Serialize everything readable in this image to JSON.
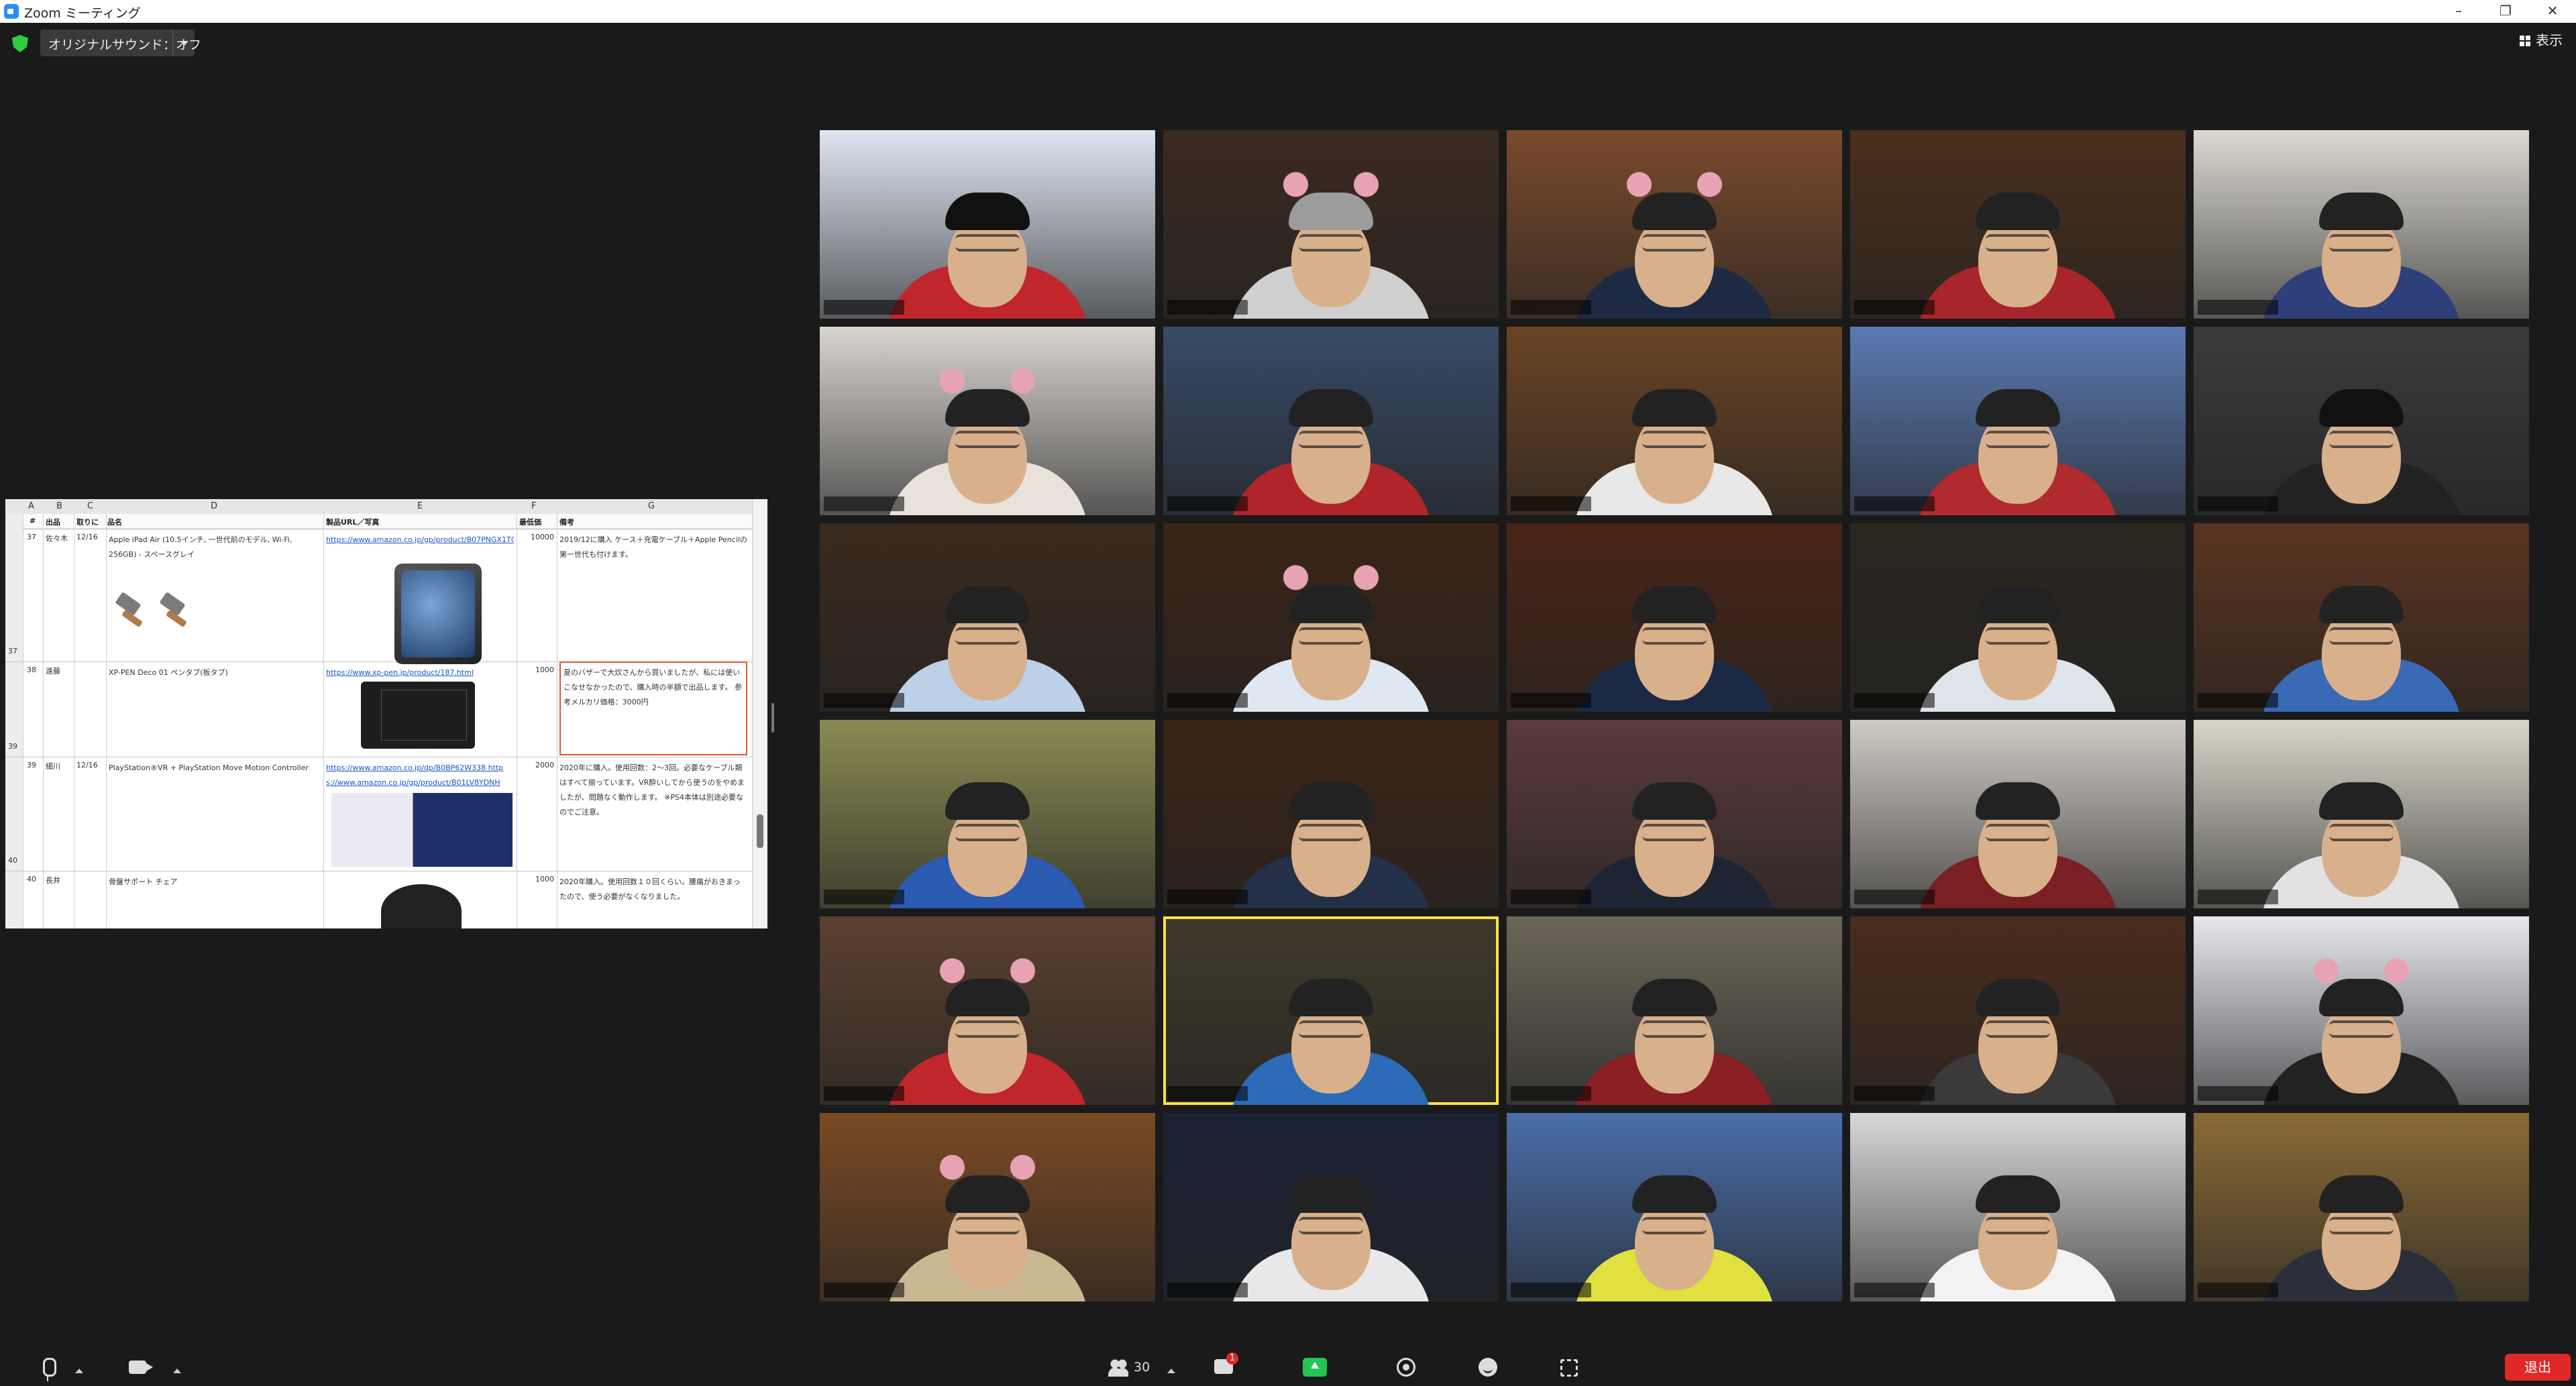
{
  "window": {
    "title": "Zoom ミーティング",
    "controls": [
      "–",
      "❐",
      "✕"
    ]
  },
  "top": {
    "sound_label": "オリジナルサウンド：オフ",
    "view_label": "表示"
  },
  "spreadsheet": {
    "columns": [
      "A",
      "B",
      "C",
      "D",
      "E",
      "F",
      "G"
    ],
    "headers": [
      "#",
      "出品",
      "取りに",
      "品名",
      "製品URL／写真",
      "最低価",
      "備考"
    ],
    "rows": [
      {
        "row_no": "37",
        "a": "37",
        "b": "佐々木",
        "c": "12/16",
        "d": "Apple iPad Air (10.5インチ, 一世代前のモデル, Wi-Fi, 256GB) - スペースグレイ",
        "e": "https://www.amazon.co.jp/gp/product/B07PNGX1TQ/",
        "f": "10000",
        "g": "2019/12に購入 ケース＋充電ケーブル＋Apple Pencilの第一世代も付けます。"
      },
      {
        "row_no": "39",
        "a": "38",
        "b": "遠藤",
        "c": "",
        "d": "XP-PEN Deco 01 ペンタブ(板タブ)",
        "e": "https://www.xp-pen.jp/product/187.html",
        "f": "1000",
        "g": "夏のバザーで大炊さんから買いましたが、私には使いこなせなかったので、購入時の半額で出品します。 参考メルカリ価格：3000円"
      },
      {
        "row_no": "40",
        "a": "39",
        "b": "細川",
        "c": "12/16",
        "d": "PlayStation®VR + PlayStation Move Motion Controller",
        "e": "https://www.amazon.co.jp/dp/B0BP62W338 https://www.amazon.co.jp/gp/product/B01LV8YDNH",
        "f": "2000",
        "g": "2020年に購入。使用回数：2〜3回。必要なケーブル類はすべて揃っています。VR酔いしてから使うのをやめましたが、問題なく動作します。 ※PS4本体は別途必要なのでご注意。"
      },
      {
        "row_no": "",
        "a": "40",
        "b": "長井",
        "c": "",
        "d": "骨盤サポート チェア",
        "e": "",
        "f": "1000",
        "g": "2020年購入。使用回数１０回くらい。腰痛がおきまったので、使う必要がなくなりました。"
      }
    ]
  },
  "grid": {
    "columns": 5,
    "rows": 6,
    "active_tile": 21,
    "tiles": [
      {
        "bg": "#dfe6f2",
        "shirt": "#c0262c",
        "hair": "#111",
        "filter": "crown"
      },
      {
        "bg": "#3b2a20",
        "shirt": "#cfcfcf",
        "hair": "#9c9c9c",
        "filter": "unicorn"
      },
      {
        "bg": "#7a4a2c",
        "shirt": "#1e2a44",
        "hair": "#222",
        "filter": "bunny"
      },
      {
        "bg": "#4a2f1c",
        "shirt": "#a8262b",
        "hair": "#222",
        "filter": "crown"
      },
      {
        "bg": "#dcd9d2",
        "shirt": "#2f3f7a",
        "hair": "#222",
        "filter": "group"
      },
      {
        "bg": "#d8d4cf",
        "shirt": "#e8e2da",
        "hair": "#222",
        "filter": "unicorn"
      },
      {
        "bg": "#384a66",
        "shirt": "#b0252a",
        "hair": "#222",
        "filter": "mustache"
      },
      {
        "bg": "#6a4424",
        "shirt": "#e8e8e8",
        "hair": "#222",
        "filter": "headphones"
      },
      {
        "bg": "#5b79b2",
        "shirt": "#b02a2e",
        "hair": "#222",
        "filter": "flowers"
      },
      {
        "bg": "#3c3a3c",
        "shirt": "#222",
        "hair": "#111",
        "filter": "none"
      },
      {
        "bg": "#3a2a1e",
        "shirt": "#bcd0e8",
        "hair": "#222",
        "filter": "sunglasses"
      },
      {
        "bg": "#3b2416",
        "shirt": "#dfe8f2",
        "hair": "#222",
        "filter": "ears"
      },
      {
        "bg": "#4a2416",
        "shirt": "#1b2a44",
        "hair": "#222",
        "filter": "zzz"
      },
      {
        "bg": "#2a2620",
        "shirt": "#dfe3ea",
        "hair": "#222",
        "filter": "sprout"
      },
      {
        "bg": "#5a3420",
        "shirt": "#3a6ab6",
        "hair": "#222",
        "filter": "none"
      },
      {
        "bg": "#8a8a52",
        "shirt": "#2b5bb0",
        "hair": "#222",
        "filter": "crown"
      },
      {
        "bg": "#3b2416",
        "shirt": "#233047",
        "hair": "#222",
        "filter": "none"
      },
      {
        "bg": "#5b3a3a",
        "shirt": "#1d2433",
        "hair": "#222",
        "filter": "crown"
      },
      {
        "bg": "#cfcac4",
        "shirt": "#7a1f24",
        "hair": "#222",
        "filter": "group"
      },
      {
        "bg": "#d8d6c8",
        "shirt": "#e2e2e2",
        "hair": "#222",
        "filter": "group"
      },
      {
        "bg": "#5b4030",
        "shirt": "#c0262c",
        "hair": "#222",
        "filter": "ears"
      },
      {
        "bg": "#3f3a2a",
        "shirt": "#2d6ab8",
        "hair": "#222",
        "filter": "none"
      },
      {
        "bg": "#6b6658",
        "shirt": "#8a1f24",
        "hair": "#222",
        "filter": "none"
      },
      {
        "bg": "#4a2c1c",
        "shirt": "#3a3a3a",
        "hair": "#222",
        "filter": "none"
      },
      {
        "bg": "#e6e8ee",
        "shirt": "#222",
        "hair": "#222",
        "filter": "reindeer"
      },
      {
        "bg": "#7a4a24",
        "shirt": "#c9b892",
        "hair": "#222",
        "filter": "pig"
      },
      {
        "bg": "#1c2236",
        "shirt": "#e8e8e8",
        "hair": "#222",
        "filter": "none"
      },
      {
        "bg": "#4a6ea8",
        "shirt": "#e0e040",
        "hair": "#222",
        "filter": "sunglasses"
      },
      {
        "bg": "#d8d8d6",
        "shirt": "#f2f2f2",
        "hair": "#222",
        "filter": "none"
      },
      {
        "bg": "#8a6a36",
        "shirt": "#2a2f3a",
        "hair": "#222",
        "filter": "beard"
      }
    ]
  },
  "toolbar": {
    "participants_count": "30",
    "chat_badge": "1",
    "leave_label": "退出"
  }
}
